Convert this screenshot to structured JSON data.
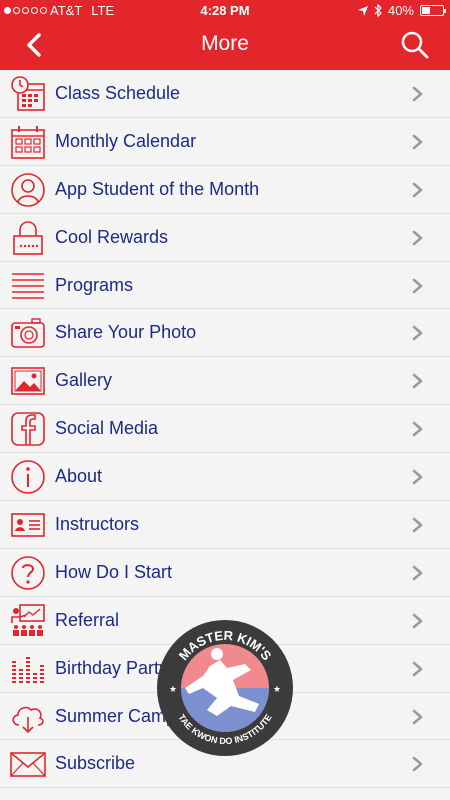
{
  "status_bar": {
    "carrier": "AT&T",
    "network": "LTE",
    "time": "4:28 PM",
    "battery": "40%",
    "battery_level": 0.4
  },
  "nav": {
    "title": "More"
  },
  "menu": [
    {
      "label": "Class Schedule",
      "icon": "calendar-clock-icon"
    },
    {
      "label": "Monthly Calendar",
      "icon": "calendar-icon"
    },
    {
      "label": "App Student of the Month",
      "icon": "user-circle-icon"
    },
    {
      "label": "Cool Rewards",
      "icon": "lock-icon"
    },
    {
      "label": "Programs",
      "icon": "list-lines-icon"
    },
    {
      "label": "Share Your Photo",
      "icon": "camera-icon"
    },
    {
      "label": "Gallery",
      "icon": "image-icon"
    },
    {
      "label": "Social Media",
      "icon": "facebook-icon"
    },
    {
      "label": "About",
      "icon": "info-icon"
    },
    {
      "label": "Instructors",
      "icon": "id-card-icon"
    },
    {
      "label": "How Do I Start",
      "icon": "question-icon"
    },
    {
      "label": "Referral",
      "icon": "presentation-icon"
    },
    {
      "label": "Birthday Party",
      "icon": "equalizer-icon"
    },
    {
      "label": "Summer Camp",
      "icon": "cloud-download-icon"
    },
    {
      "label": "Subscribe",
      "icon": "envelope-icon"
    }
  ],
  "logo": {
    "top_text": "MASTER KIM'S",
    "bottom_text": "TAE KWON DO INSTITUTE"
  },
  "colors": {
    "header": "#e3262c",
    "icon": "#e3262c",
    "label": "#1c2b84",
    "chevron": "#9a9a9a"
  }
}
